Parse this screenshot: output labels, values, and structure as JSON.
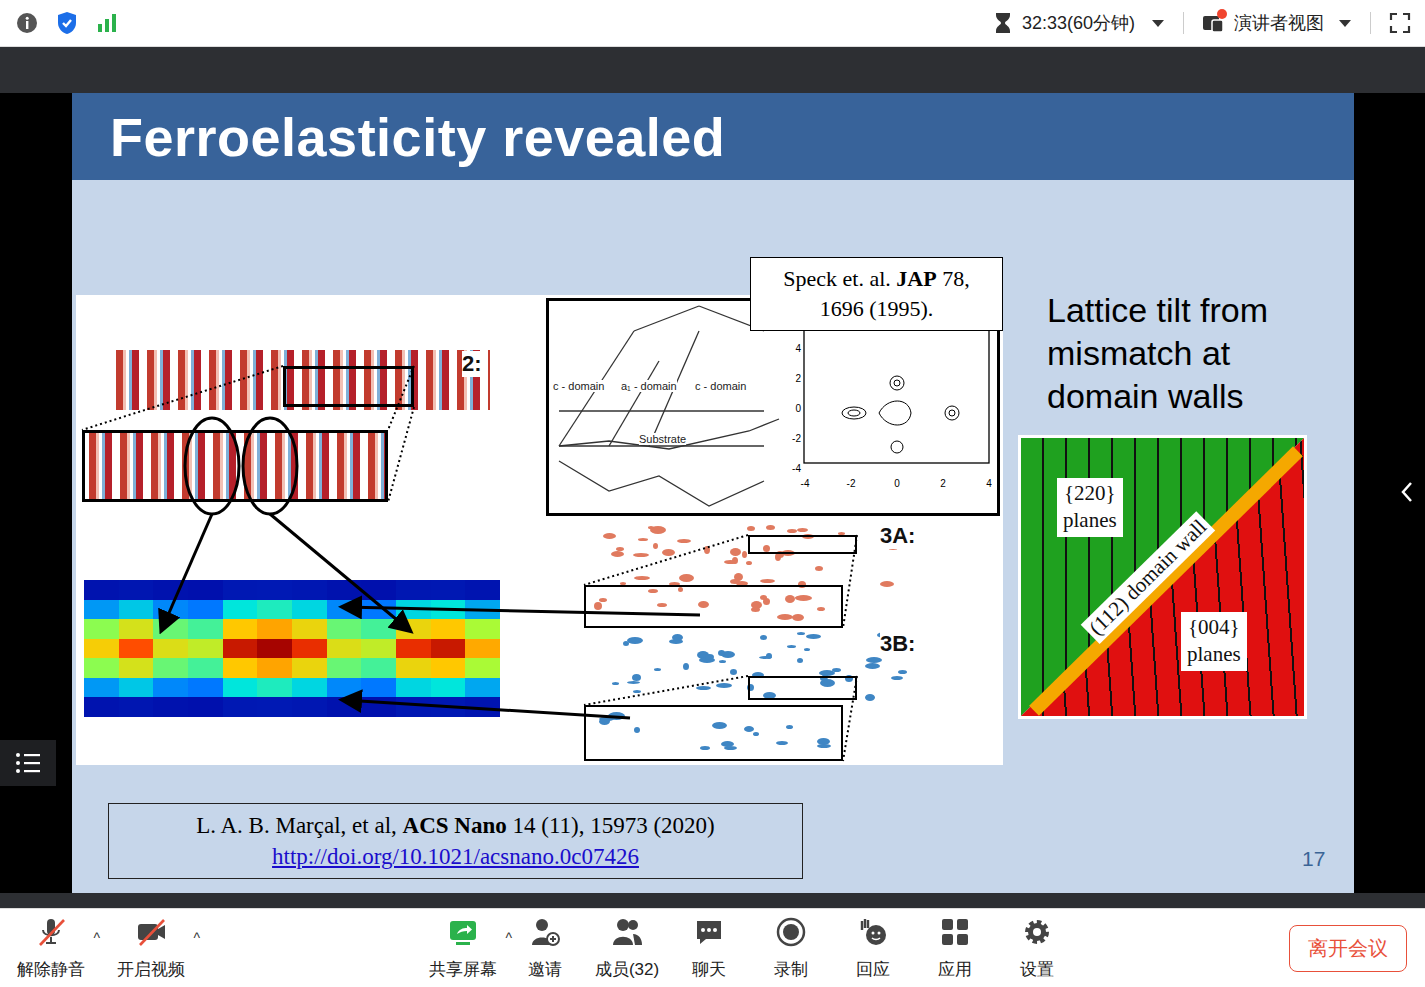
{
  "top_bar": {
    "timer": "32:33(60分钟)",
    "view": "演讲者视图",
    "view_notification": true
  },
  "slide": {
    "title": "Ferroelasticity revealed",
    "figure_labels": [
      "2:",
      "3A:",
      "3B:"
    ],
    "diagram": {
      "labels": [
        "c - domain",
        "a₁ - domain",
        "c - domain",
        "Substrate"
      ],
      "y_ticks": [
        "4",
        "2",
        "0",
        "-2",
        "-4"
      ],
      "x_ticks": [
        "-4",
        "-2",
        "0",
        "2",
        "4"
      ]
    },
    "speck_cite": {
      "authors": "Speck et. al. ",
      "journal": "JAP",
      "volume": " 78,",
      "pages": "1696 (1995)."
    },
    "side_text": "Lattice tilt from mismatch at domain walls",
    "domain_figure": {
      "upper": "{220}",
      "upper2": "planes",
      "wall": "(112) domain wall",
      "lower": "{004}",
      "lower2": "planes"
    },
    "reference": {
      "authors": "L. A. B. Marçal, et al, ",
      "journal": "ACS Nano",
      "rest": " 14 (11), 15973 (2020)",
      "link": "http://doi.org/10.1021/acsnano.0c07426"
    },
    "page_number": "17"
  },
  "toolbar": {
    "items": [
      {
        "label": "解除静音",
        "kind": "mic",
        "off": true,
        "has_menu": true
      },
      {
        "label": "开启视频",
        "kind": "video",
        "off": true,
        "has_menu": true
      },
      {
        "label": "共享屏幕",
        "kind": "share",
        "off": false,
        "has_menu": true
      },
      {
        "label": "邀请",
        "kind": "invite",
        "off": false,
        "has_menu": false
      },
      {
        "label": "成员(32)",
        "kind": "members",
        "off": false,
        "has_menu": false
      },
      {
        "label": "聊天",
        "kind": "chat",
        "off": false,
        "has_menu": false
      },
      {
        "label": "录制",
        "kind": "record",
        "off": false,
        "has_menu": false
      },
      {
        "label": "回应",
        "kind": "react",
        "off": false,
        "has_menu": false
      },
      {
        "label": "应用",
        "kind": "apps",
        "off": false,
        "has_menu": false
      },
      {
        "label": "设置",
        "kind": "settings",
        "off": false,
        "has_menu": false
      }
    ],
    "menu_caret": "^",
    "leave_button": "离开会议"
  }
}
